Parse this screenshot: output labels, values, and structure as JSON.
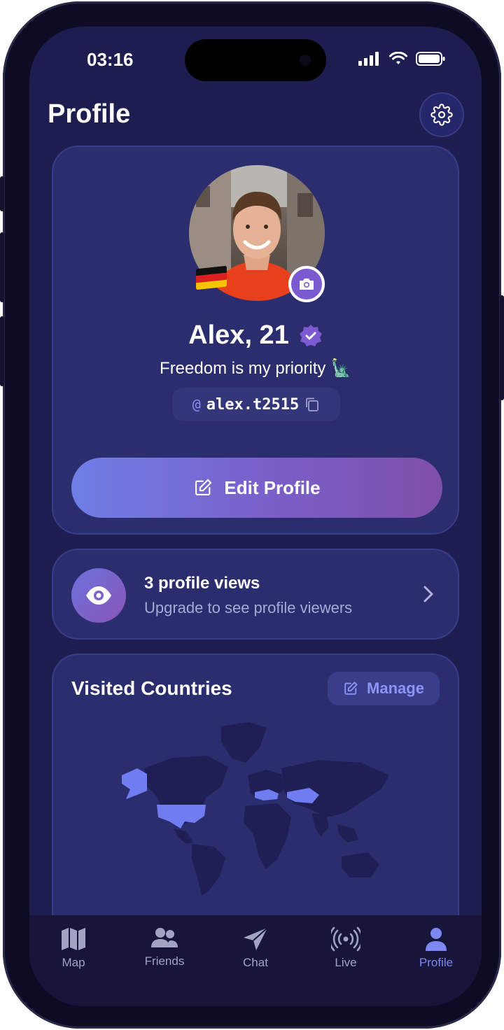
{
  "status": {
    "time": "03:16"
  },
  "header": {
    "title": "Profile"
  },
  "profile": {
    "name": "Alex, 21",
    "bio": "Freedom is my priority 🗽",
    "handle_at": "@",
    "handle": "alex.t2515",
    "edit_label": "Edit Profile"
  },
  "views": {
    "title": "3 profile views",
    "subtitle": "Upgrade to see profile viewers"
  },
  "countries": {
    "title": "Visited Countries",
    "manage_label": "Manage"
  },
  "tabs": [
    {
      "label": "Map",
      "icon": "map-icon"
    },
    {
      "label": "Friends",
      "icon": "friends-icon"
    },
    {
      "label": "Chat",
      "icon": "send-icon"
    },
    {
      "label": "Live",
      "icon": "broadcast-icon"
    },
    {
      "label": "Profile",
      "icon": "person-icon"
    }
  ],
  "colors": {
    "accent": "#7d88f2",
    "background": "#1e1d4f",
    "card": "#2c2d6e"
  }
}
